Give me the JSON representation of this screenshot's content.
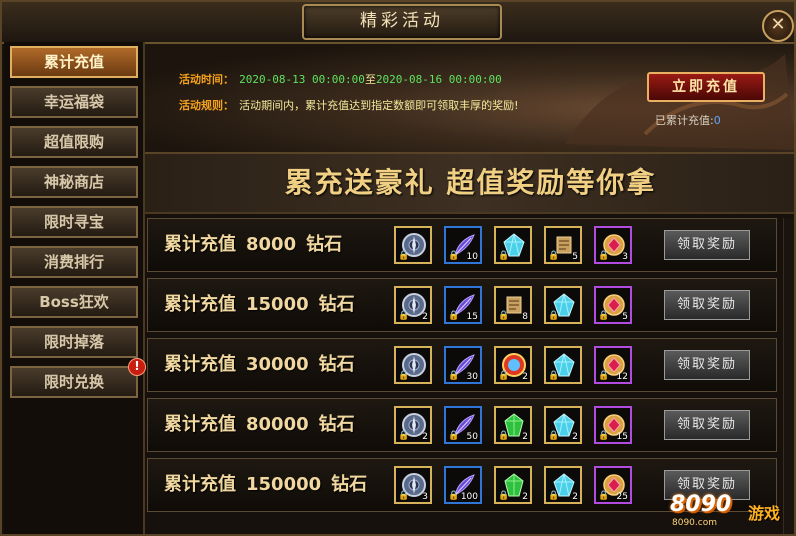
{
  "window": {
    "title": "精彩活动",
    "close_label": "✕"
  },
  "sidebar": {
    "items": [
      {
        "label": "累计充值",
        "active": true
      },
      {
        "label": "幸运福袋",
        "active": false
      },
      {
        "label": "超值限购",
        "active": false
      },
      {
        "label": "神秘商店",
        "active": false
      },
      {
        "label": "限时寻宝",
        "active": false
      },
      {
        "label": "消费排行",
        "active": false
      },
      {
        "label": "Boss狂欢",
        "active": false
      },
      {
        "label": "限时掉落",
        "active": false
      },
      {
        "label": "限时兑换",
        "active": false
      }
    ],
    "alert_label": "!"
  },
  "activity": {
    "time_label": "活动时间：",
    "time_start": "2020-08-13 00:00:00",
    "time_sep": "至",
    "time_end": "2020-08-16 00:00:00",
    "rule_label": "活动规则：",
    "rule_text": "活动期间内，累计充值达到指定数额即可领取丰厚的奖励!",
    "recharge_button": "立即充值",
    "total_label": "已累计充值:",
    "total_value": "0"
  },
  "slogan": "累充送豪礼   超值奖励等你拿",
  "tiers": [
    {
      "prefix": "累计充值",
      "amount": "8000",
      "unit": "钻石",
      "claim": "领取奖励",
      "items": [
        {
          "icon": "compass-icon",
          "border": "gold",
          "count": ""
        },
        {
          "icon": "feather-icon",
          "border": "blue",
          "count": "10"
        },
        {
          "icon": "crystal-icon",
          "border": "gold",
          "count": ""
        },
        {
          "icon": "scroll-icon",
          "border": "gold",
          "count": "5"
        },
        {
          "icon": "ruby-icon",
          "border": "purple",
          "count": "3"
        }
      ]
    },
    {
      "prefix": "累计充值",
      "amount": "15000",
      "unit": "钻石",
      "claim": "领取奖励",
      "items": [
        {
          "icon": "compass-icon",
          "border": "gold",
          "count": "2"
        },
        {
          "icon": "feather-icon",
          "border": "blue",
          "count": "15"
        },
        {
          "icon": "scroll-icon",
          "border": "gold",
          "count": "8"
        },
        {
          "icon": "crystal-icon",
          "border": "gold",
          "count": ""
        },
        {
          "icon": "ruby-icon",
          "border": "purple",
          "count": "5"
        }
      ]
    },
    {
      "prefix": "累计充值",
      "amount": "30000",
      "unit": "钻石",
      "claim": "领取奖励",
      "items": [
        {
          "icon": "compass-icon",
          "border": "gold",
          "count": ""
        },
        {
          "icon": "feather-icon",
          "border": "blue",
          "count": "30"
        },
        {
          "icon": "orb-icon",
          "border": "gold",
          "count": "2"
        },
        {
          "icon": "crystal-icon",
          "border": "gold",
          "count": ""
        },
        {
          "icon": "ruby-icon",
          "border": "purple",
          "count": "12"
        }
      ]
    },
    {
      "prefix": "累计充值",
      "amount": "80000",
      "unit": "钻石",
      "claim": "领取奖励",
      "items": [
        {
          "icon": "compass-icon",
          "border": "gold",
          "count": "2"
        },
        {
          "icon": "feather-icon",
          "border": "blue",
          "count": "50"
        },
        {
          "icon": "emerald-icon",
          "border": "gold",
          "count": "2"
        },
        {
          "icon": "crystal-icon",
          "border": "gold",
          "count": "2"
        },
        {
          "icon": "ruby-icon",
          "border": "purple",
          "count": "15"
        }
      ]
    },
    {
      "prefix": "累计充值",
      "amount": "150000",
      "unit": "钻石",
      "claim": "领取奖励",
      "items": [
        {
          "icon": "compass-icon",
          "border": "gold",
          "count": "3"
        },
        {
          "icon": "feather-icon",
          "border": "blue",
          "count": "100"
        },
        {
          "icon": "emerald-icon",
          "border": "gold",
          "count": "2"
        },
        {
          "icon": "crystal-icon",
          "border": "gold",
          "count": "2"
        },
        {
          "icon": "ruby-icon",
          "border": "purple",
          "count": "25"
        }
      ]
    }
  ],
  "item_lock_glyph": "🔒",
  "watermark": {
    "number": "8090",
    "text": "游戏",
    "url": "8090.com"
  },
  "colors": {
    "accent": "#f5a21b",
    "date": "#5fe25f",
    "total_value": "#5fa8ff",
    "active_tab": "#b06a28"
  }
}
